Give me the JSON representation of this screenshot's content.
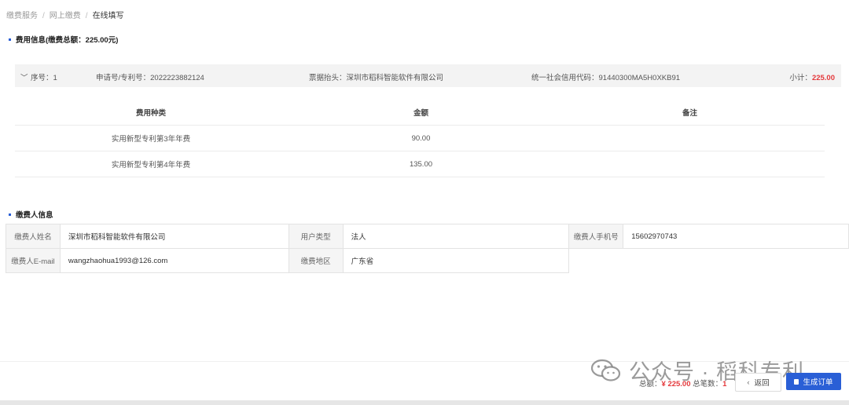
{
  "breadcrumb": [
    "缴费服务",
    "网上缴费",
    "在线填写"
  ],
  "fee_info": {
    "title": "费用信息(缴费总额：225.00元)",
    "order": {
      "seq": "序号：1",
      "application_no": "申请号/专利号：2022223882124",
      "invoice_title": "票据抬头：深圳市稻科智能软件有限公司",
      "credit_code": "统一社会信用代码：91440300MA5H0XKB91",
      "subtotal_label": "小计：",
      "subtotal_value": "225.00"
    },
    "table": {
      "headers": [
        "费用种类",
        "金额",
        "备注"
      ],
      "rows": [
        {
          "type": "实用新型专利第3年年费",
          "amount": "90.00",
          "note": ""
        },
        {
          "type": "实用新型专利第4年年费",
          "amount": "135.00",
          "note": ""
        }
      ]
    }
  },
  "payer_info": {
    "title": "缴费人信息",
    "name_label": "缴费人姓名",
    "name_value": "深圳市稻科智能软件有限公司",
    "user_type_label": "用户类型",
    "user_type_value": "法人",
    "phone_label": "缴费人手机号",
    "phone_value": "15602970743",
    "email_label": "缴费人E-mail",
    "email_value": "wangzhaohua1993@126.com",
    "region_label": "缴费地区",
    "region_value": "广东省"
  },
  "footer": {
    "total_label": "总额：",
    "total_value": "¥ 225.00",
    "count_label": "总笔数：",
    "count_value": "1",
    "back_label": "返回",
    "create_order_label": "生成订单"
  },
  "watermark": "公众号 · 稻科专利",
  "colors": {
    "accent": "#2a5fd6",
    "price": "#e4393c"
  }
}
